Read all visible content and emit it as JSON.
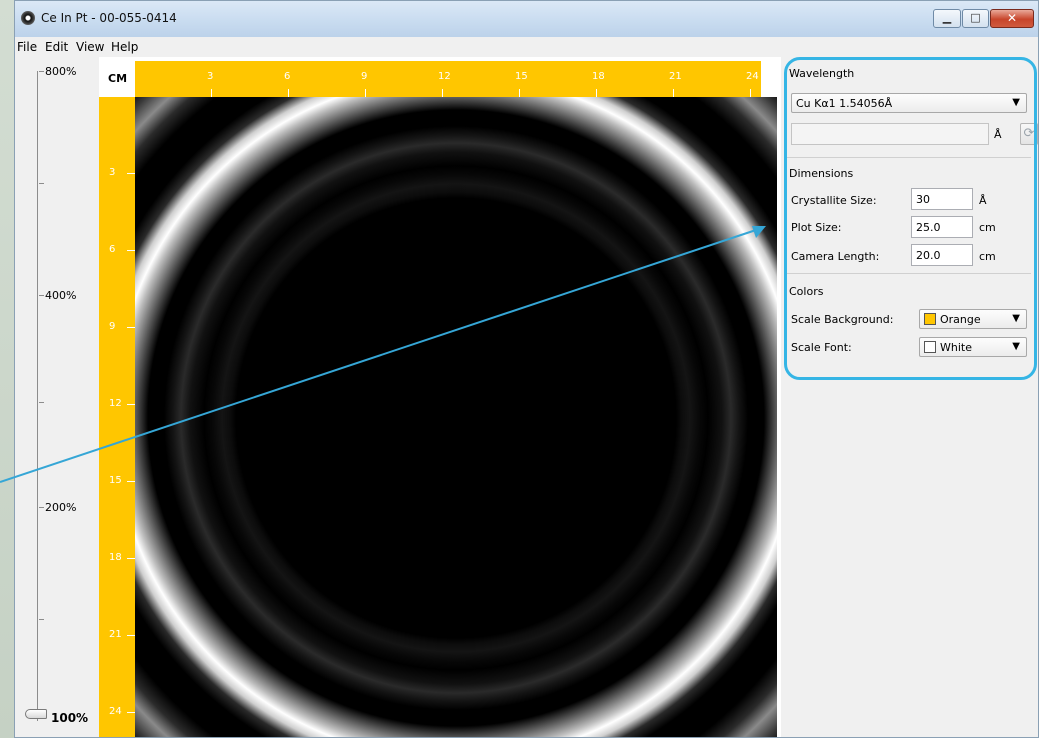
{
  "window": {
    "title": "Ce In Pt - 00-055-0414"
  },
  "menu": [
    "File",
    "Edit",
    "View",
    "Help"
  ],
  "zoom": {
    "labels": [
      "800%",
      "400%",
      "200%",
      "100%"
    ],
    "current": "100%"
  },
  "scale": {
    "corner_label": "CM",
    "h_ticks": [
      "3",
      "6",
      "9",
      "12",
      "15",
      "18",
      "21",
      "24"
    ],
    "v_ticks": [
      "3",
      "6",
      "9",
      "12",
      "15",
      "18",
      "21",
      "24"
    ]
  },
  "wavelength": {
    "title": "Wavelength",
    "selected": "Cu Kα1 1.54056Å",
    "custom_value": "",
    "unit": "Å"
  },
  "dimensions": {
    "title": "Dimensions",
    "crystallite": {
      "label": "Crystallite Size:",
      "value": "30",
      "unit": "Å"
    },
    "plot": {
      "label": "Plot Size:",
      "value": "25.0",
      "unit": "cm"
    },
    "camera": {
      "label": "Camera Length:",
      "value": "20.0",
      "unit": "cm"
    }
  },
  "colors": {
    "title": "Colors",
    "background": {
      "label": "Scale Background:",
      "value": "Orange",
      "swatch": "#ffc600"
    },
    "font": {
      "label": "Scale Font:",
      "value": "White",
      "swatch": "#ffffff"
    }
  },
  "accent": {
    "highlight": "#35b5e5",
    "scale": "#ffc600"
  },
  "icons": {
    "app": "diffraction-icon",
    "refresh": "refresh-icon",
    "minimize": "minimize-icon",
    "maximize": "maximize-icon",
    "close": "close-icon"
  }
}
